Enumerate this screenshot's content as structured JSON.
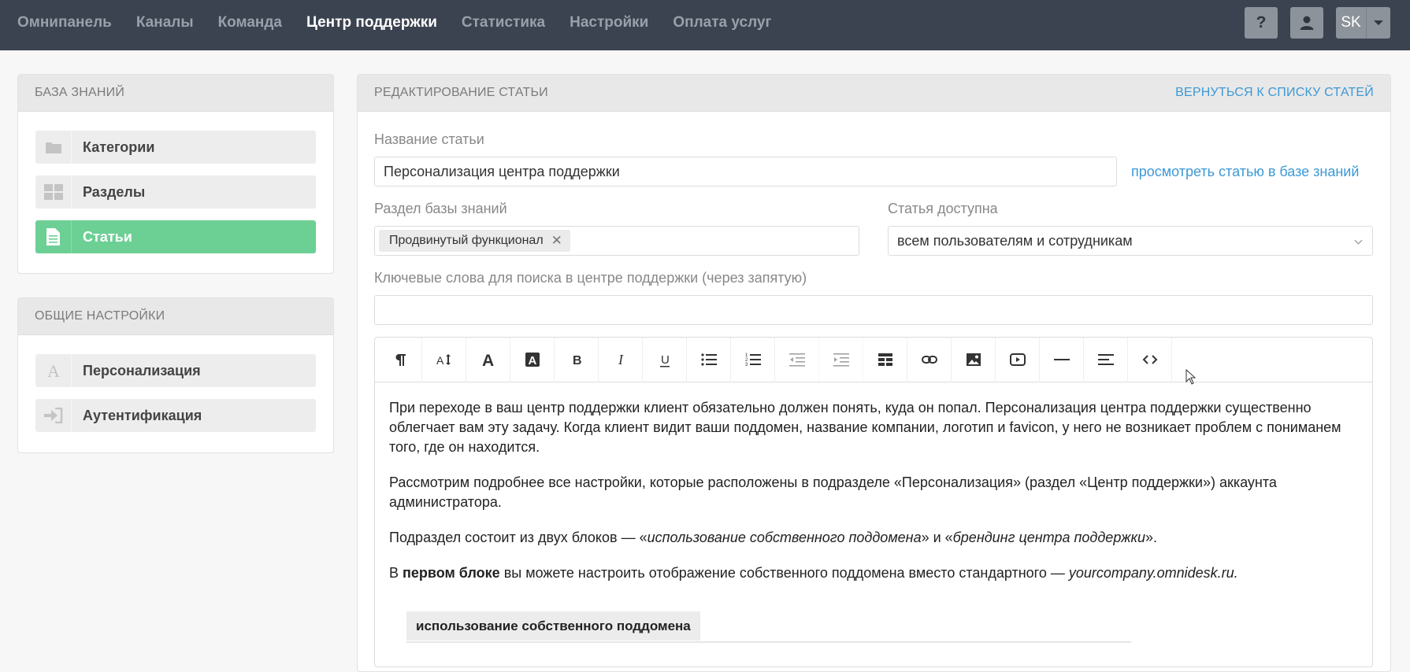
{
  "topnav": {
    "items": [
      {
        "label": "Омнипанель"
      },
      {
        "label": "Каналы"
      },
      {
        "label": "Команда"
      },
      {
        "label": "Центр поддержки"
      },
      {
        "label": "Статистика"
      },
      {
        "label": "Настройки"
      },
      {
        "label": "Оплата услуг"
      }
    ],
    "active_index": 3,
    "help_label": "?",
    "user_initials": "SK"
  },
  "sidebar": {
    "knowledge_base": {
      "title": "БАЗА ЗНАНИЙ",
      "items": [
        {
          "label": "Категории",
          "icon": "folder-icon"
        },
        {
          "label": "Разделы",
          "icon": "grid-icon"
        },
        {
          "label": "Статьи",
          "icon": "document-icon",
          "active": true
        }
      ]
    },
    "general_settings": {
      "title": "ОБЩИЕ НАСТРОЙКИ",
      "items": [
        {
          "label": "Персонализация",
          "icon": "letter-a-icon"
        },
        {
          "label": "Аутентификация",
          "icon": "sign-in-icon"
        }
      ]
    }
  },
  "editor_page": {
    "title": "РЕДАКТИРОВАНИЕ СТАТЬИ",
    "back_link": "ВЕРНУТЬСЯ К СПИСКУ СТАТЕЙ",
    "article_name_label": "Название статьи",
    "article_name_value": "Персонализация центра поддержки",
    "view_link": "просмотреть статью в базе знаний",
    "section_label": "Раздел базы знаний",
    "section_tag": "Продвинутый функционал",
    "access_label": "Статья доступна",
    "access_value": "всем пользователям и сотрудникам",
    "keywords_label": "Ключевые слова для поиска в центре поддержки (через запятую)",
    "keywords_value": ""
  },
  "toolbar": [
    "paragraph-icon",
    "font-size-icon",
    "text-color-icon",
    "background-color-icon",
    "bold-icon",
    "italic-icon",
    "underline-icon",
    "bulleted-list-icon",
    "numbered-list-icon",
    "outdent-icon",
    "indent-icon",
    "table-icon",
    "link-icon",
    "image-icon",
    "video-icon",
    "horizontal-rule-icon",
    "align-icon",
    "code-view-icon"
  ],
  "content": {
    "p1": "При переходе в ваш центр поддержки клиент обязательно должен понять, куда он попал. Персонализация центра поддержки существенно облегчает вам эту задачу. Когда клиент видит ваши поддомен, название компании, логотип и favicon, у него не возникает проблем с пониманем того, где он находится.",
    "p2": "Рассмотрим подробнее все настройки, которые расположены в подразделе «Персонализация» (раздел «Центр поддержки») аккаунта администратора.",
    "p3_a": "Подраздел состоит из двух блоков — «",
    "p3_em1": "использование собственного поддомена",
    "p3_b": "» и «",
    "p3_em2": "брендинг центра поддержки",
    "p3_c": "».",
    "p4_a": "В ",
    "p4_strong": "первом блоке",
    "p4_b": " вы можете настроить отображение собственного поддомена вместо стандартного — ",
    "p4_em": "yourcompany.omnidesk.ru.",
    "screenshot_tab": "использование собственного поддомена"
  }
}
